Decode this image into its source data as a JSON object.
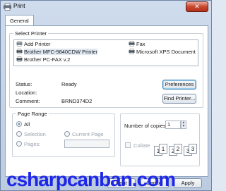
{
  "window": {
    "title": "Print",
    "close_glyph": "✕"
  },
  "tabs": [
    {
      "label": "General"
    }
  ],
  "select_printer": {
    "group_label": "Select Printer",
    "printers": [
      {
        "name": "Add Printer",
        "icon": "add-printer-icon"
      },
      {
        "name": "Brother MFC-9840CDW Printer",
        "icon": "printer-icon",
        "selected": true
      },
      {
        "name": "Brother PC-FAX v.2",
        "icon": "fax-icon"
      },
      {
        "name": "Fax",
        "icon": "fax-icon"
      },
      {
        "name": "Microsoft XPS Document",
        "icon": "printer-icon"
      }
    ],
    "status_label": "Status:",
    "status_value": "Ready",
    "location_label": "Location:",
    "location_value": "",
    "comment_label": "Comment:",
    "comment_value": "BRND374D2",
    "preferences_button": "Preferences",
    "find_printer_button": "Find Printer..."
  },
  "page_range": {
    "group_label": "Page Range",
    "all_label": "All",
    "selection_label": "Selection",
    "current_page_label": "Current Page",
    "pages_label": "Pages:",
    "pages_value": ""
  },
  "copies": {
    "label": "Number of copies:",
    "value": "1",
    "collate_label": "Collate",
    "collate_digits": [
      "1",
      "1",
      "2",
      "2",
      "3",
      "3"
    ]
  },
  "footer": {
    "watermark": "csharpcanban.com",
    "print_button": "Print",
    "cancel_button": "Cancel",
    "apply_button": "Apply"
  }
}
